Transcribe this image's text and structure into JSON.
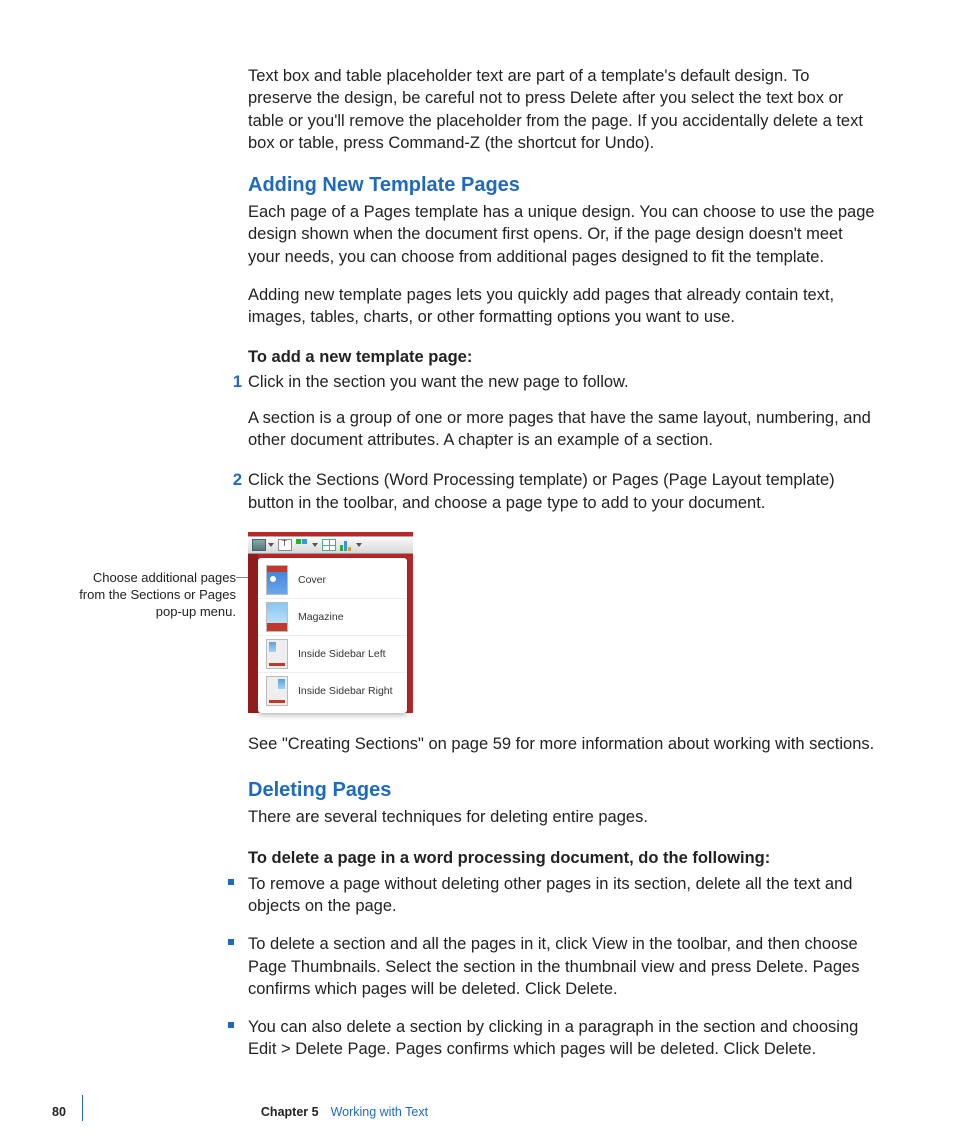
{
  "paragraphs": {
    "intro": "Text box and table placeholder text are part of a template's default design. To preserve the design, be careful not to press Delete after you select the text box or table or you'll remove the placeholder from the page. If you accidentally delete a text box or table, press Command-Z (the shortcut for Undo)."
  },
  "sections": {
    "adding": {
      "heading": "Adding New Template Pages",
      "p1": "Each page of a Pages template has a unique design. You can choose to use the page design shown when the document first opens. Or, if the page design doesn't meet your needs, you can choose from additional pages designed to fit the template.",
      "p2": "Adding new template pages lets you quickly add pages that already contain text, images, tables, charts, or other formatting options you want to use.",
      "task_heading": "To add a new template page:",
      "steps": [
        {
          "num": "1",
          "text": "Click in the section you want the new page to follow.",
          "sub": "A section is a group of one or more pages that have the same layout, numbering, and other document attributes. A chapter is an example of a section."
        },
        {
          "num": "2",
          "text": "Click the Sections (Word Processing template) or Pages (Page Layout template) button in the toolbar, and choose a page type to add to your document."
        }
      ],
      "callout": "Choose additional pages from the Sections or Pages pop-up menu.",
      "menu_items": [
        "Cover",
        "Magazine",
        "Inside Sidebar Left",
        "Inside Sidebar Right"
      ],
      "after_figure": "See \"Creating Sections\" on page 59 for more information about working with sections."
    },
    "deleting": {
      "heading": "Deleting Pages",
      "p1": "There are several techniques for deleting entire pages.",
      "task_heading": "To delete a page in a word processing document, do the following:",
      "bullets": [
        "To remove a page without deleting other pages in its section, delete all the text and objects on the page.",
        "To delete a section and all the pages in it, click View in the toolbar, and then choose Page Thumbnails. Select the section in the thumbnail view and press Delete. Pages confirms which pages will be deleted. Click Delete.",
        "You can also delete a section by clicking in a paragraph in the section and choosing Edit > Delete Page. Pages confirms which pages will be deleted. Click Delete."
      ]
    }
  },
  "footer": {
    "page_number": "80",
    "chapter_label": "Chapter 5",
    "chapter_title": "Working with Text"
  }
}
